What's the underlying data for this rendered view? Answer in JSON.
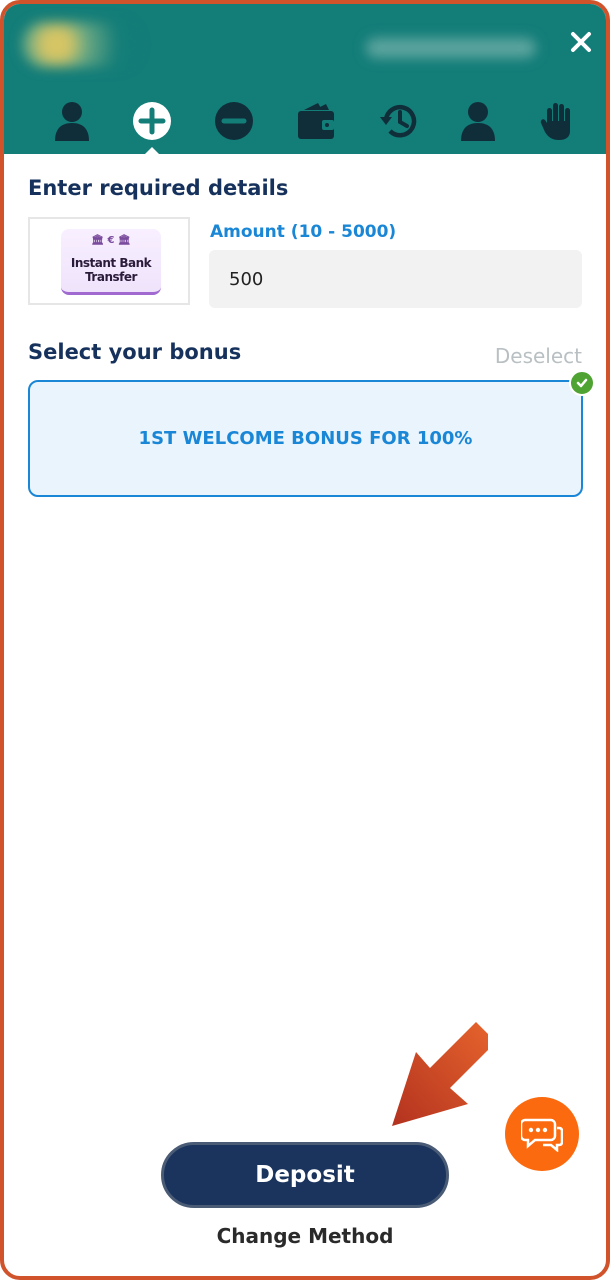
{
  "header": {
    "close_icon": "close-icon",
    "tabs": [
      {
        "icon": "user-icon"
      },
      {
        "icon": "plus-circle-icon",
        "active": true
      },
      {
        "icon": "minus-circle-icon"
      },
      {
        "icon": "wallet-icon"
      },
      {
        "icon": "history-icon"
      },
      {
        "icon": "profile-icon"
      },
      {
        "icon": "hand-icon"
      }
    ]
  },
  "form": {
    "title": "Enter required details",
    "method_logo_top": "€",
    "method_logo_text": "Instant Bank Transfer",
    "amount_label": "Amount (10 - 5000)",
    "amount_value": "500"
  },
  "bonus": {
    "title": "Select your bonus",
    "deselect_label": "Deselect",
    "selected_bonus": "1ST WELCOME BONUS FOR 100%"
  },
  "actions": {
    "deposit_label": "Deposit",
    "change_method_label": "Change Method"
  },
  "colors": {
    "header_bg": "#137d78",
    "accent_blue": "#1a86d6",
    "navy": "#16325c",
    "deposit_bg": "#1a345e",
    "chat_orange": "#fb6a0e",
    "frame_border": "#d0532b"
  }
}
